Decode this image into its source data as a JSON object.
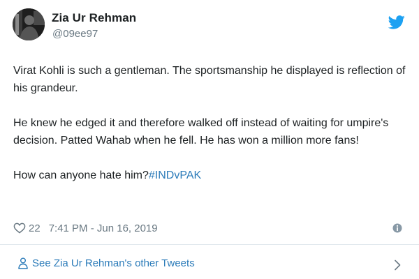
{
  "author": {
    "display_name": "Zia Ur Rehman",
    "handle": "@09ee97",
    "avatar_icon": "user-avatar-photo"
  },
  "brand": {
    "logo_icon": "twitter-bird-icon",
    "color": "#1da1f2"
  },
  "tweet": {
    "paragraphs": [
      "Virat Kohli is such a gentleman. The sportsmanship he displayed is reflection of his grandeur.",
      "He knew he edged it and therefore walked off instead of waiting for umpire's decision. Patted Wahab when he fell. He has won a million more fans!"
    ],
    "last_line_text": "How can anyone hate him?",
    "hashtag": "#INDvPAK",
    "link_color": "#2b7bb9"
  },
  "meta": {
    "like_icon": "heart-icon",
    "like_count": "22",
    "timestamp": "7:41 PM - Jun 16, 2019",
    "info_icon": "info-icon"
  },
  "footer": {
    "other_tweets_label": "See Zia Ur Rehman's other Tweets",
    "person_icon": "person-icon",
    "chevron_icon": "chevron-right-icon"
  }
}
